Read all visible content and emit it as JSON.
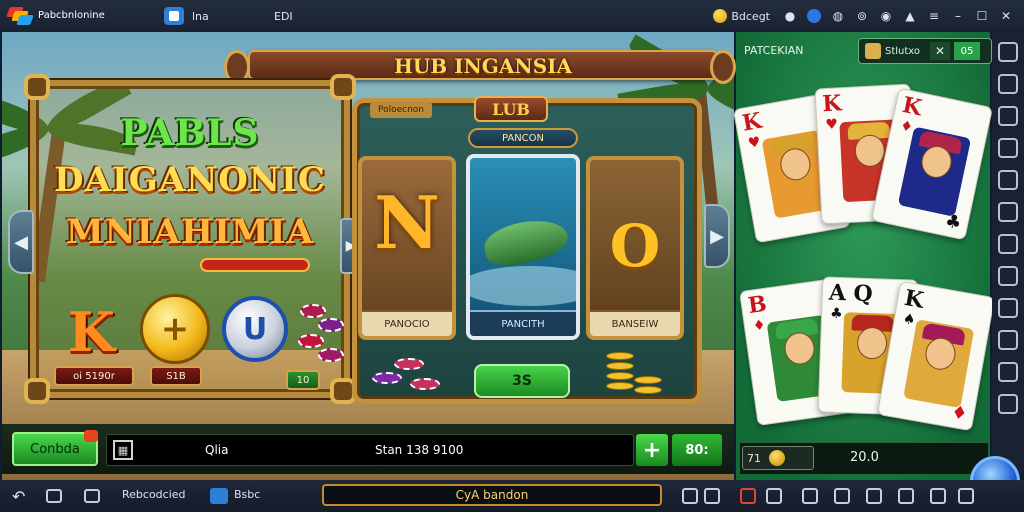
{
  "window": {
    "app_name_line1": "Pabcbnlonine",
    "app_name_line2": "",
    "tab1": "lna",
    "tab2": "EDI",
    "coins": "Bdcegt",
    "controls": [
      "●",
      "◍",
      "⊚",
      "▲",
      "☐",
      "✕"
    ]
  },
  "game": {
    "banner_title": "HUB INGANSIA",
    "title_line1": "PABLS",
    "title_line2": "DAIGANONIC",
    "title_line3": "MNIAHIMIA",
    "symbol_k": "K",
    "symbol_coin": "+",
    "symbol_u": "U",
    "tag_left": "oi 5190r",
    "tag_mid": "S1B",
    "tag_green": "10",
    "small_tab": "Poloecnon",
    "lub": "LUB",
    "pancon": "PANCON",
    "reels": [
      {
        "label": "PANOCIO",
        "glyph": "N"
      },
      {
        "label": "PANCITH",
        "glyph": ""
      },
      {
        "label": "BANSEIW",
        "glyph": "O"
      }
    ],
    "bet_button": "3S",
    "confirm_button": "Conbda",
    "confirm_badge": "",
    "input_left": "Qlia",
    "input_right": "Stan 138 9100",
    "plus": "+",
    "value_button": "80:"
  },
  "cards_panel": {
    "title": "PATCEKIAN",
    "pill_label": "Stlutxo",
    "pill_close": "✕",
    "pill_num": "05",
    "top_cards": [
      {
        "rank": "K",
        "suit": "♥",
        "suit_big": ""
      },
      {
        "rank": "K",
        "suit": "♥",
        "suit_big": ""
      },
      {
        "rank": "K",
        "suit": "♦",
        "suit_big": "♣"
      }
    ],
    "bottom_cards": [
      {
        "rank": "B",
        "suit": "♦",
        "suit_big": ""
      },
      {
        "rank": "A Q",
        "suit": "♣",
        "suit_big": ""
      },
      {
        "rank": "K",
        "suit": "♠",
        "suit_big": "♦"
      }
    ],
    "footer_tag": "71",
    "footer_value": "20.0"
  },
  "bottom_bar": {
    "app_label": "Rebcodcied",
    "app2_label": "Bsbc",
    "center_label": "CyA bandon"
  }
}
